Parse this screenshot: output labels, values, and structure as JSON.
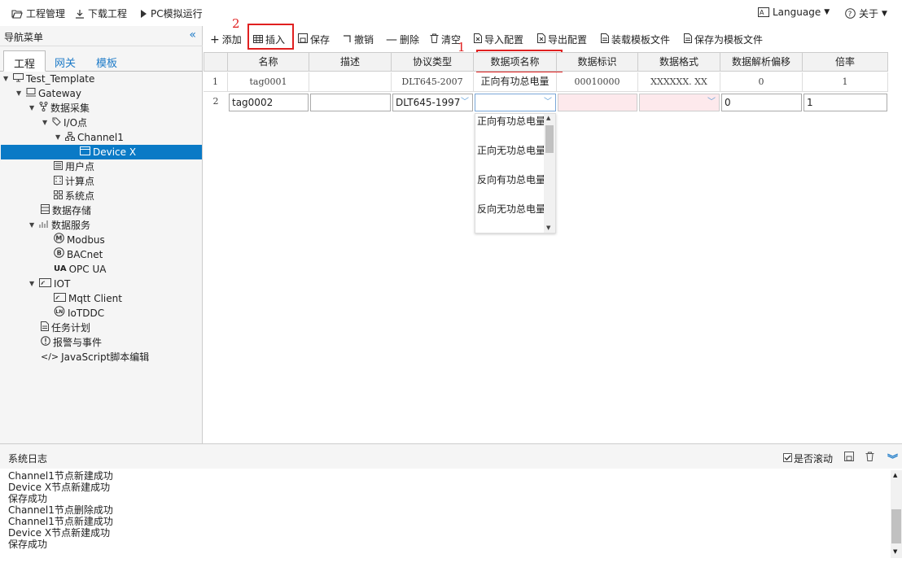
{
  "topbar": {
    "project_mgmt": "工程管理",
    "download_project": "下载工程",
    "pc_sim_run": "PC模拟运行",
    "language": "Language",
    "about": "关于"
  },
  "sidebar": {
    "title": "导航菜单",
    "tabs": [
      "工程",
      "网关",
      "模板"
    ],
    "tree": [
      "Test_Template",
      "Gateway",
      "数据采集",
      "I/O点",
      "Channel1",
      "Device X",
      "用户点",
      "计算点",
      "系统点",
      "数据存储",
      "数据服务",
      "Modbus",
      "BACnet",
      "OPC UA",
      "IOT",
      "Mqtt Client",
      "IoTDDC",
      "任务计划",
      "报警与事件",
      "JavaScript脚本编辑"
    ]
  },
  "toolbar": {
    "add": "添加",
    "insert": "插入",
    "save": "保存",
    "undo": "撤销",
    "delete": "删除",
    "clear": "清空",
    "import_config": "导入配置",
    "export_config": "导出配置",
    "load_template": "装载模板文件",
    "save_as_template": "保存为模板文件"
  },
  "annotations": {
    "mark1": "1",
    "mark2": "2"
  },
  "grid": {
    "columns": [
      "名称",
      "描述",
      "协议类型",
      "数据项名称",
      "数据标识",
      "数据格式",
      "数据解析偏移",
      "倍率"
    ],
    "rows": [
      {
        "num": "1",
        "name": "tag0001",
        "desc": "",
        "protocol": "DLT645-2007",
        "item": "正向有功总电量",
        "id": "00010000",
        "format": "XXXXXX. XX",
        "offset": "0",
        "rate": "1"
      },
      {
        "num": "2",
        "name": "tag0002",
        "desc": "",
        "protocol": "DLT645-1997",
        "item": "",
        "id": "",
        "format": "",
        "offset": "0",
        "rate": "1"
      }
    ]
  },
  "dropdown": {
    "options": [
      "正向有功总电量",
      "正向无功总电量",
      "反向有功总电量",
      "反向无功总电量"
    ]
  },
  "log": {
    "title": "系统日志",
    "autoscroll_label": "是否滚动",
    "lines": [
      "Channel1节点新建成功",
      "Device X节点新建成功",
      "保存成功",
      "Channel1节点删除成功",
      "Channel1节点新建成功",
      "Device X节点新建成功",
      "保存成功"
    ]
  }
}
